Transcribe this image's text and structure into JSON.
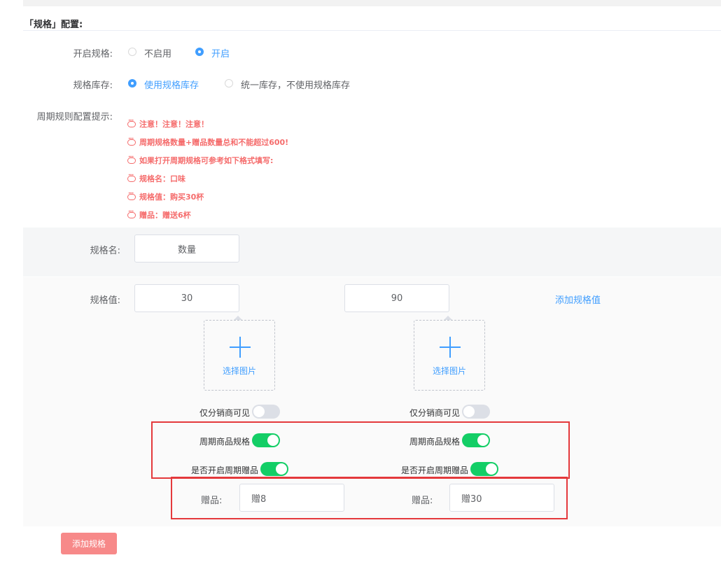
{
  "section_title": "「规格」配置:",
  "enable_spec": {
    "label": "开启规格:",
    "options": [
      "不启用",
      "开启"
    ],
    "selected": "开启"
  },
  "spec_stock": {
    "label": "规格库存:",
    "options": [
      "使用规格库存",
      "统一库存，不使用规格库存"
    ],
    "selected": "使用规格库存"
  },
  "cycle_tips": {
    "label": "周期规则配置提示:",
    "items": [
      "注意！注意！注意！",
      "周期规格数量+赠品数量总和不能超过600!",
      "如果打开周期规格可参考如下格式填写:",
      "规格名：口味",
      "规格值：购买30杯",
      "赠品：赠送6杯"
    ],
    "color": "#f56c6c"
  },
  "spec_name": {
    "label": "规格名:",
    "value": "数量"
  },
  "spec_values": {
    "label": "规格值:",
    "add_value_link": "添加规格值",
    "items": [
      {
        "value": "30",
        "select_image": "选择图片",
        "distributor_only": {
          "label": "仅分销商可见",
          "on": false
        },
        "cycle_spec": {
          "label": "周期商品规格",
          "on": true
        },
        "cycle_gift": {
          "label": "是否开启周期赠品",
          "on": true
        },
        "gift": {
          "label": "赠品:",
          "value": "赠8"
        }
      },
      {
        "value": "90",
        "select_image": "选择图片",
        "distributor_only": {
          "label": "仅分销商可见",
          "on": false
        },
        "cycle_spec": {
          "label": "周期商品规格",
          "on": true
        },
        "cycle_gift": {
          "label": "是否开启周期赠品",
          "on": true
        },
        "gift": {
          "label": "赠品:",
          "value": "赠30"
        }
      }
    ]
  },
  "add_spec_button": "添加规格",
  "colors": {
    "primary": "#409eff",
    "switch_on": "#13ce66",
    "danger_button": "#f78989",
    "highlight_border": "#e4393c"
  }
}
